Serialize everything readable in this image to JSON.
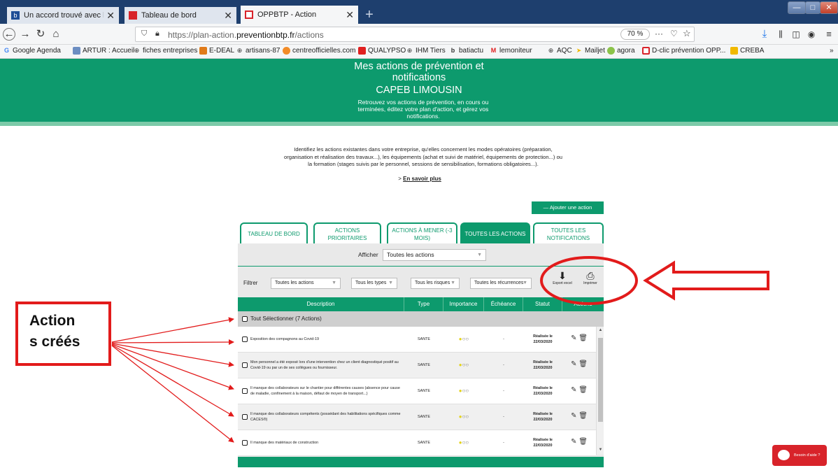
{
  "browser": {
    "tabs": [
      {
        "title": "Un accord trouvé avec l'Etat po",
        "favicon": "b",
        "favicon_color": "#1f4e96"
      },
      {
        "title": "Tableau de bord",
        "favicon": "",
        "favicon_color": "#d8232a"
      },
      {
        "title": "OPPBTP - Action",
        "favicon": "",
        "favicon_color": "#d8232a"
      }
    ],
    "new_tab": "+",
    "url_prefix": "https://plan-action.",
    "url_domain": "preventionbtp.fr",
    "url_path": "/actions",
    "zoom": "70 %",
    "page_actions": "···",
    "bookmarks": [
      "Google Agenda",
      "ARTUR : Accueil",
      "fiches entreprises",
      "E-DEAL",
      "artisans-87",
      "centreofficielles.com",
      "QUALYPSO",
      "IHM Tiers",
      "batiactu",
      "lemoniteur",
      "AQC",
      "Mailjet",
      "agora",
      "D-clic prévention OPP...",
      "CREBA"
    ]
  },
  "hero": {
    "title_line1": "Mes actions de prévention et",
    "title_line2": "notifications",
    "org": "CAPEB LIMOUSIN",
    "subtitle": "Retrouvez vos actions de prévention, en cours ou terminées, éditez votre plan d'action, et gérez vos notifications."
  },
  "intro": {
    "text": "Identifiez les actions existantes dans votre entreprise, qu'elles concernent les modes opératoires (préparation, organisation et réalisation des travaux...), les équipements (achat et suivi de matériel, équipements de protection...) ou la formation (stages suivis par le personnel, sessions de sensibilisation, formations obligatoires...).",
    "more_prefix": "> ",
    "more_link": "En savoir plus"
  },
  "add_action": "—  Ajouter une action",
  "tabs": [
    {
      "label": "TABLEAU DE BORD"
    },
    {
      "label": "ACTIONS PRIORITAIRES"
    },
    {
      "label": "ACTIONS À MENER (-3 MOIS)"
    },
    {
      "label": "TOUTES LES ACTIONS"
    },
    {
      "label": "TOUTES LES NOTIFICATIONS"
    }
  ],
  "afficher": {
    "label": "Afficher",
    "value": "Toutes les actions"
  },
  "filters": {
    "label": "Filtrer",
    "actions": "Toutes les actions",
    "types": "Tous les types",
    "risques": "Tous les risques",
    "recurrences": "Toutes les récurrences",
    "export": "Export excel",
    "print": "Imprimer"
  },
  "table": {
    "headers": [
      "Description",
      "Type",
      "Importance",
      "Échéance",
      "Statut",
      "Actions"
    ],
    "select_all": "Tout Sélectionner (7 Actions)",
    "rows": [
      {
        "desc": "Exposition des compagnons au Covid-19",
        "type": "SANTE",
        "echeance": "-",
        "statut1": "Réalisée le",
        "statut2": "22/03/2020"
      },
      {
        "desc": "Mon personnel a été exposé lors d'une intervention chez un client diagnostiqué positif au Covid-19 ou par un de ses collègues ou fournisseur.",
        "type": "SANTE",
        "echeance": "-",
        "statut1": "Réalisée le",
        "statut2": "22/03/2020"
      },
      {
        "desc": "Il manque des collaborateurs sur le chantier pour différentes causes (absence pour cause de maladie, confinement à la maison, défaut de moyen de transport...)",
        "type": "SANTE",
        "echeance": "-",
        "statut1": "Réalisée le",
        "statut2": "22/03/2020"
      },
      {
        "desc": "Il manque des collaborateurs compétents (possédant des habilitations spécifiques comme CACES®)",
        "type": "SANTE",
        "echeance": "-",
        "statut1": "Réalisée le",
        "statut2": "22/03/2020"
      },
      {
        "desc": "Il manque des matériaux de construction",
        "type": "SANTE",
        "echeance": "-",
        "statut1": "Réalisée le",
        "statut2": "22/03/2020"
      }
    ]
  },
  "help": "Besoin d'aide ?",
  "annotation": {
    "line1": "Action",
    "line2": "s créés"
  },
  "colors": {
    "brand_green": "#0d9a6d",
    "annotation_red": "#e21b1b",
    "help_red": "#d8232a",
    "importance_dot": "#e3d31d"
  }
}
